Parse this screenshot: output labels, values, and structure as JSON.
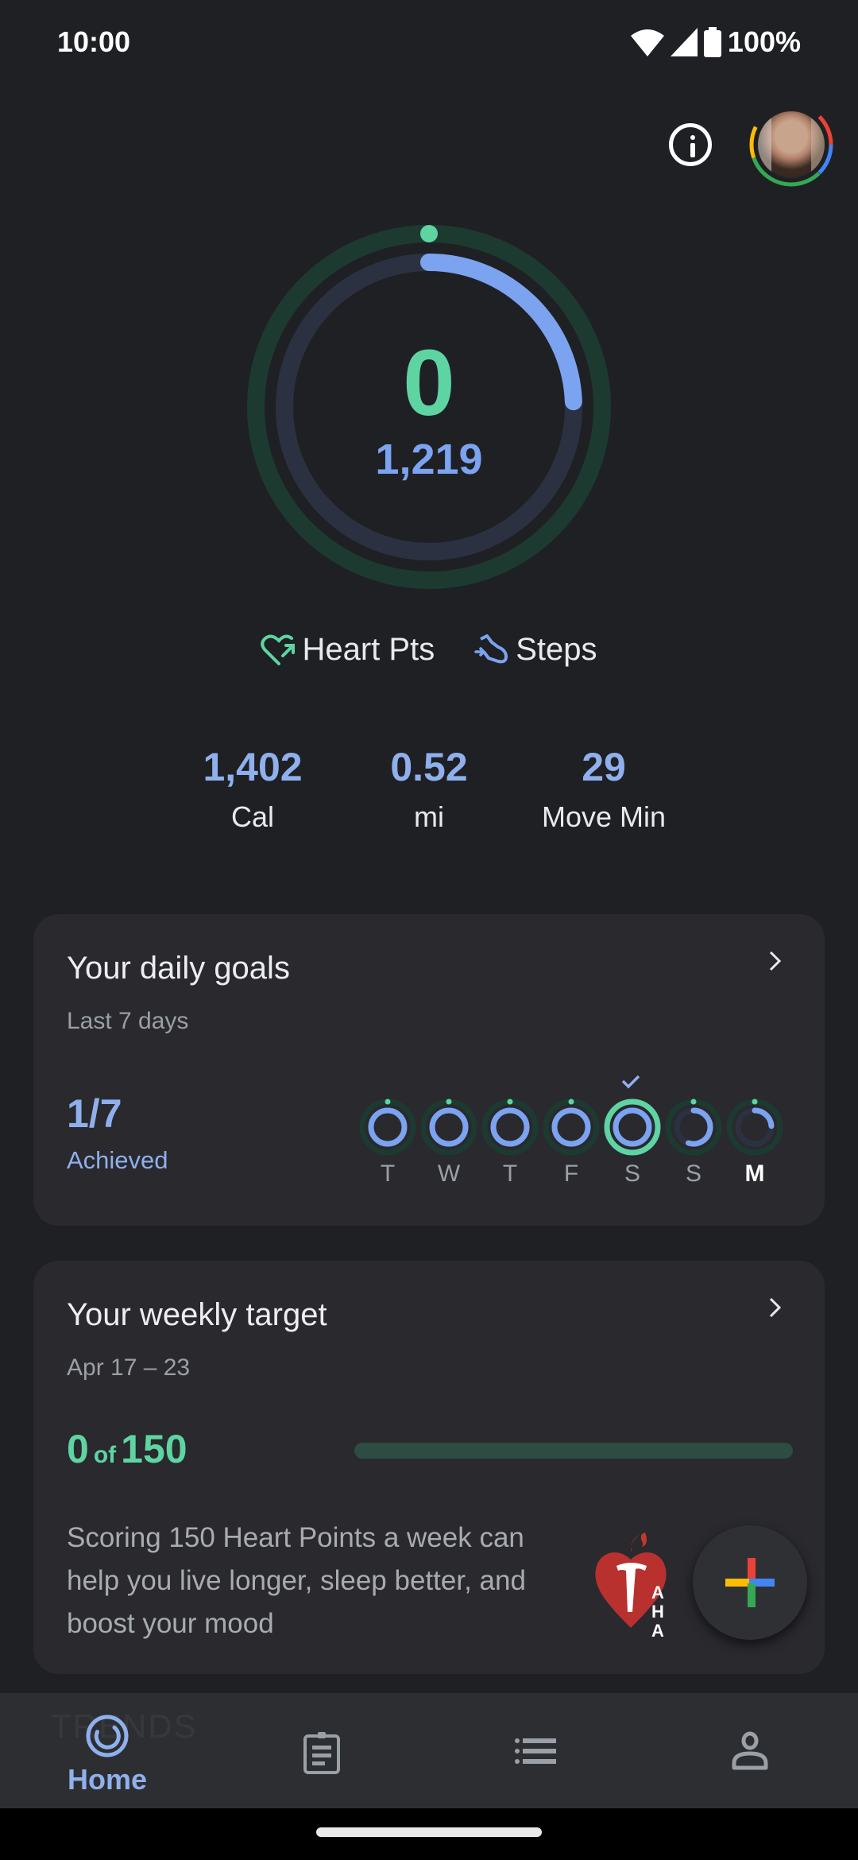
{
  "status_bar": {
    "time": "10:00",
    "battery": "100%",
    "icons": [
      "wifi-icon",
      "signal-icon",
      "battery-icon"
    ]
  },
  "header": {
    "info_icon": "info-icon",
    "avatar": "profile-avatar"
  },
  "summary": {
    "heart_points": "0",
    "steps": "1,219",
    "heart_points_goal_progress": 0.0,
    "steps_goal_progress": 0.244,
    "colors": {
      "heart": "#5fd4a3",
      "steps": "#7ba3f0"
    },
    "legend": [
      {
        "icon": "heart-points-icon",
        "label": "Heart Pts"
      },
      {
        "icon": "steps-icon",
        "label": "Steps"
      }
    ]
  },
  "stats": [
    {
      "value": "1,402",
      "label": "Cal"
    },
    {
      "value": "0.52",
      "label": "mi"
    },
    {
      "value": "29",
      "label": "Move Min"
    }
  ],
  "daily_goals": {
    "title": "Your daily goals",
    "subtitle": "Last 7 days",
    "achieved_count": "1/7",
    "achieved_label": "Achieved",
    "days": [
      {
        "label": "T",
        "steps_progress": 1.0,
        "heart_progress": 0.0,
        "achieved": false,
        "today": false
      },
      {
        "label": "W",
        "steps_progress": 1.0,
        "heart_progress": 0.0,
        "achieved": false,
        "today": false
      },
      {
        "label": "T",
        "steps_progress": 1.0,
        "heart_progress": 0.0,
        "achieved": false,
        "today": false
      },
      {
        "label": "F",
        "steps_progress": 1.0,
        "heart_progress": 0.0,
        "achieved": false,
        "today": false
      },
      {
        "label": "S",
        "steps_progress": 1.0,
        "heart_progress": 1.0,
        "achieved": true,
        "today": false
      },
      {
        "label": "S",
        "steps_progress": 0.55,
        "heart_progress": 0.0,
        "achieved": false,
        "today": false
      },
      {
        "label": "M",
        "steps_progress": 0.24,
        "heart_progress": 0.0,
        "achieved": false,
        "today": true
      }
    ]
  },
  "weekly_target": {
    "title": "Your weekly target",
    "date_range": "Apr 17 – 23",
    "current": "0",
    "of_label": "of",
    "goal": "150",
    "progress": 0.0,
    "description": "Scoring 150 Heart Points a week can help you live longer, sleep better, and boost your mood",
    "partner_logo": "american-heart-association-logo",
    "partner_text": [
      "A",
      "H",
      "A"
    ]
  },
  "fab": {
    "icon": "add-icon"
  },
  "nav": {
    "ghost_text": "TRENDS",
    "items": [
      {
        "label": "Home",
        "icon": "home-rings-icon",
        "active": true
      },
      {
        "label": "",
        "icon": "journal-icon",
        "active": false
      },
      {
        "label": "",
        "icon": "browse-list-icon",
        "active": false
      },
      {
        "label": "",
        "icon": "profile-icon",
        "active": false
      }
    ]
  }
}
